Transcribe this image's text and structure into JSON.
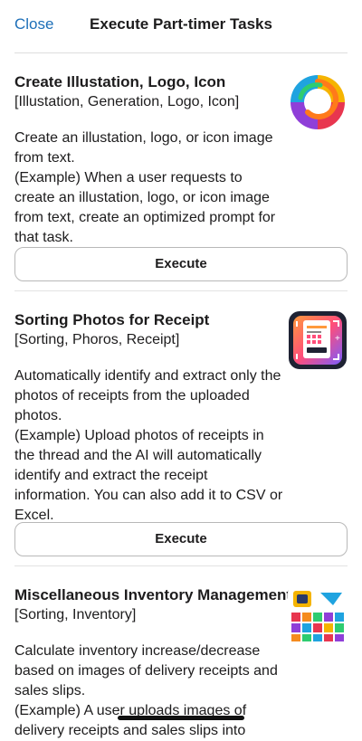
{
  "header": {
    "close_label": "Close",
    "title": "Execute Part-timer Tasks"
  },
  "tasks": [
    {
      "title": "Create Illustation, Logo, Icon",
      "tags": "[Illustation, Generation, Logo, Icon]",
      "description": "Create an illustation, logo, or icon image from text.\n(Example) When a user requests to create an illustation, logo, or icon image from text, create an optimized prompt for that task.",
      "button_label": "Execute",
      "icon": "colorful-swirl-logo-icon"
    },
    {
      "title": "Sorting Photos for Receipt",
      "tags": "[Sorting, Phoros, Receipt]",
      "description": "Automatically identify and extract only the photos of receipts from the uploaded photos.\n(Example) Upload photos of receipts in the thread and the AI will automatically identify and extract the receipt information. You can also add it to CSV or Excel.",
      "button_label": "Execute",
      "icon": "receipt-scan-icon"
    },
    {
      "title": "Miscellaneous Inventory Management",
      "tags": "[Sorting, Inventory]",
      "description": "Calculate inventory increase/decrease based on images of delivery receipts and sales slips.\n(Example) A user uploads images of delivery receipts and sales slips into",
      "icon": "inventory-boxes-icon"
    }
  ]
}
